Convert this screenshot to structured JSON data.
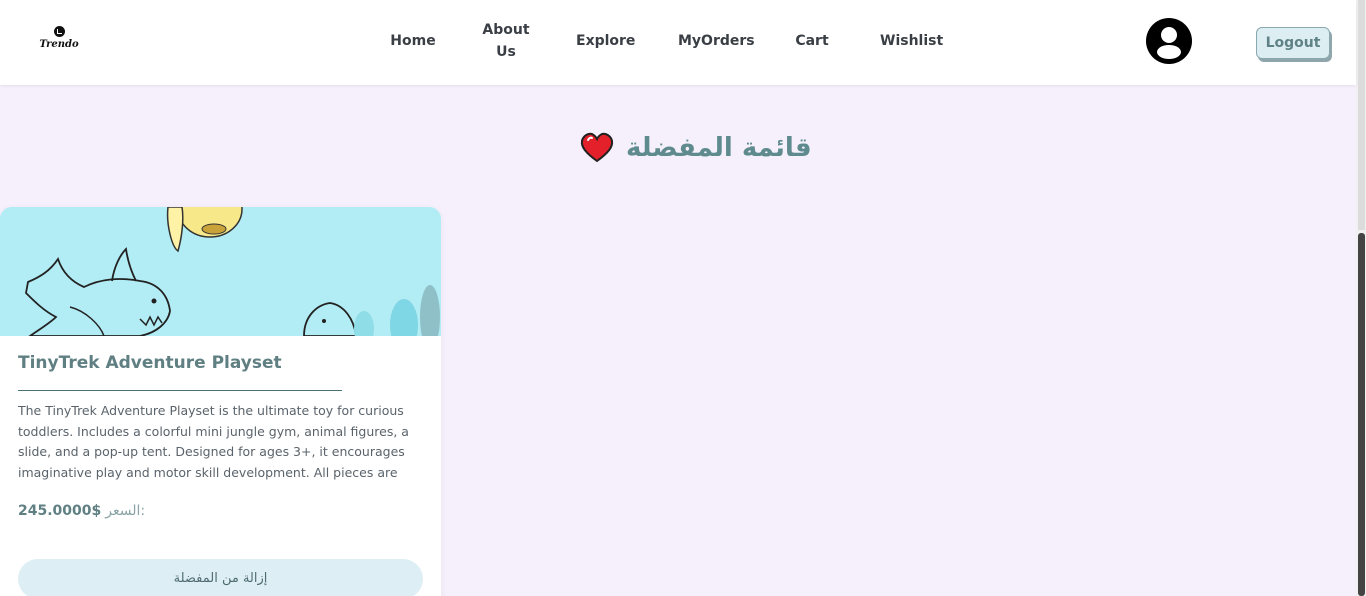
{
  "brand": {
    "logo_text": "Trendo"
  },
  "nav": {
    "home": "Home",
    "about": "About Us",
    "explore": "Explore",
    "orders": "MyOrders",
    "cart": "Cart",
    "wishlist": "Wishlist"
  },
  "header": {
    "logout_label": "Logout",
    "avatar_icon": "user-avatar-icon"
  },
  "page": {
    "title": "قائمة المفضلة",
    "title_icon": "heart-icon"
  },
  "wishlist_items": [
    {
      "name": "TinyTrek Adventure Playset",
      "description": "The TinyTrek Adventure Playset is the ultimate toy for curious toddlers. Includes a colorful mini jungle gym, animal figures, a slide, and a pop-up tent. Designed for ages 3+, it encourages imaginative play and motor skill development. All pieces are made",
      "price_label": "السعر:",
      "price_value": "245.0000$",
      "remove_label": "إزالة من المفضلة"
    }
  ],
  "colors": {
    "page_bg": "#f6f0fc",
    "accent": "#5f8b8e",
    "image_bg": "#b2ecf4",
    "button_bg": "#ddeef5"
  }
}
